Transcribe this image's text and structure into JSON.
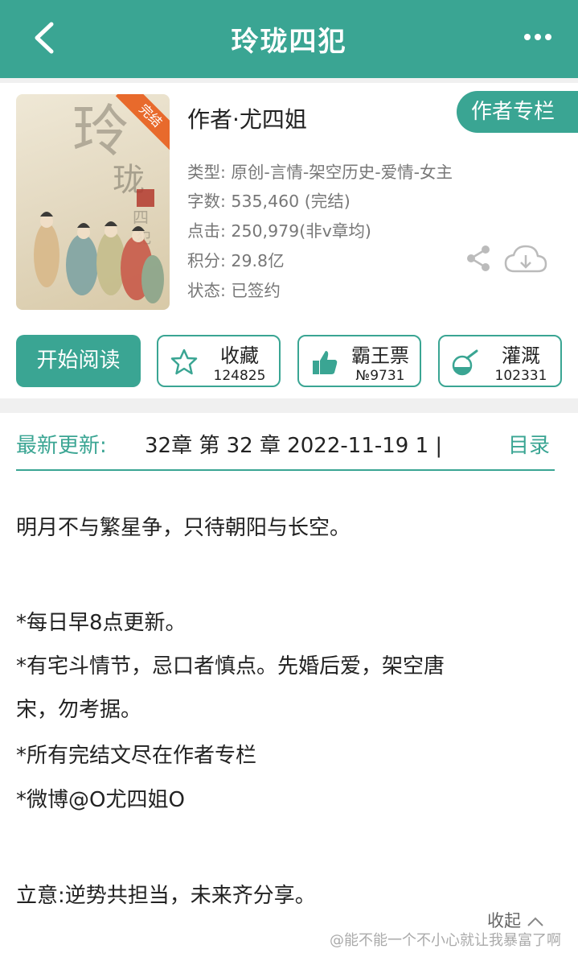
{
  "header": {
    "title": "玲珑四犯",
    "back_icon": "chevron-left-icon",
    "more_icon": "more-dots-icon"
  },
  "book": {
    "cover_badge": "完结",
    "author_line": "作者·尤四姐",
    "author_column_label": "作者专栏",
    "meta": [
      "类型: 原创-言情-架空历史-爱情-女主",
      "字数: 535,460 (完结)",
      "点击: 250,979(非v章均)",
      "积分: 29.8亿",
      "状态: 已签约"
    ]
  },
  "actions": {
    "start_read": "开始阅读",
    "favorite": {
      "label": "收藏",
      "count": "124825",
      "icon": "star-icon"
    },
    "vote": {
      "label": "霸王票",
      "count": "№9731",
      "icon": "thumbs-up-icon"
    },
    "water": {
      "label": "灌溉",
      "count": "102331",
      "icon": "watering-flask-icon"
    }
  },
  "latest": {
    "label": "最新更新:",
    "text": "32章  第 32 章  2022-11-19 1 |",
    "toc_label": "目录"
  },
  "intro": {
    "lines": [
      "明月不与繁星争，只待朝阳与长空。",
      "*每日早8点更新。",
      " *有宅斗情节，忌口者慎点。先婚后爱，架空唐",
      "宋，勿考据。",
      "*所有完结文尽在作者专栏",
      "*微博@O尤四姐O",
      "立意:逆势共担当，未来齐分享。"
    ],
    "collapse_label": "收起"
  },
  "watermark": "@能不能一个不小心就让我暴富了啊",
  "colors": {
    "accent": "#3aa593",
    "badge": "#e86a2c"
  }
}
